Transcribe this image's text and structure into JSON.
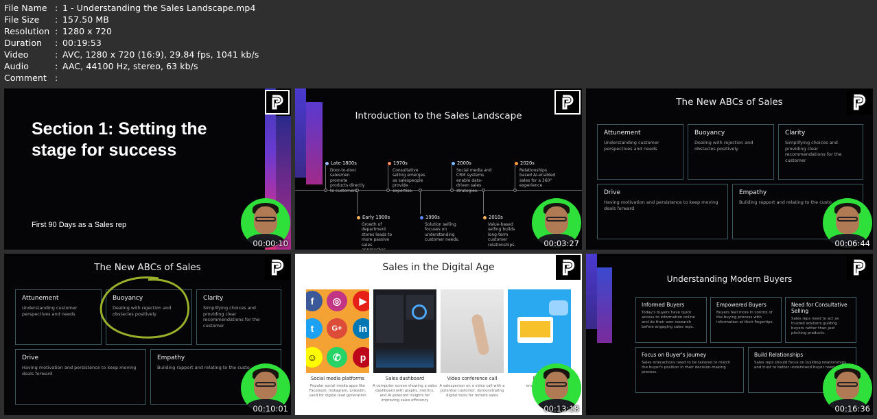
{
  "file_info": [
    {
      "key": "File Name",
      "value": "1 - Understanding the Sales Landscape.mp4"
    },
    {
      "key": "File Size",
      "value": "157.50 MB"
    },
    {
      "key": "Resolution",
      "value": "1280 x 720"
    },
    {
      "key": "Duration",
      "value": "00:19:53"
    },
    {
      "key": "Video",
      "value": "AVC, 1280 x 720 (16:9), 29.84 fps, 1041 kb/s"
    },
    {
      "key": "Audio",
      "value": "AAC, 44100 Hz, stereo, 63 kb/s"
    },
    {
      "key": "Comment",
      "value": ""
    }
  ],
  "separator": ":",
  "thumbs": {
    "t1": {
      "time": "00:00:10",
      "title": "Section 1: Setting the stage for success",
      "subtitle": "First 90 Days as a Sales rep"
    },
    "t2": {
      "time": "00:03:27",
      "title": "Introduction to the Sales Landscape",
      "top_items": [
        {
          "year": "Late 1800s",
          "text": "Door-to-door salesmen promote products directly to customers.",
          "color": "#9ab8ff"
        },
        {
          "year": "1970s",
          "text": "Consultative selling emerges as salespeople provide expertise.",
          "color": "#ff8a5a"
        },
        {
          "year": "2000s",
          "text": "Social media and CRM systems enable data-driven sales strategies.",
          "color": "#7ab8ff"
        },
        {
          "year": "2020s",
          "text": "Relationships based AI-enabled sales for a 360° experience",
          "color": "#ff9a3a"
        }
      ],
      "bottom_items": [
        {
          "year": "Early 1900s",
          "text": "Growth of department stores leads to more passive sales approaches.",
          "color": "#ffb25a"
        },
        {
          "year": "1990s",
          "text": "Solution selling focuses on understanding customer needs.",
          "color": "#5a8aff"
        },
        {
          "year": "2010s",
          "text": "Value-based selling builds long-term customer relationships.",
          "color": "#ffb25a"
        }
      ]
    },
    "t3": {
      "time": "00:06:44",
      "title": "The New ABCs of Sales"
    },
    "t4": {
      "time": "00:10:01",
      "title": "The New ABCs of Sales"
    },
    "abc_cards": [
      {
        "h": "Attunement",
        "d": "Understanding customer perspectives and needs"
      },
      {
        "h": "Buoyancy",
        "d": "Dealing with rejection and obstacles positively"
      },
      {
        "h": "Clarity",
        "d": "Simplifying choices and providing clear recommendations for the customer"
      },
      {
        "h": "Drive",
        "d": "Having motivation and persistence to keep moving deals forward"
      },
      {
        "h": "Empathy",
        "d": "Building rapport and relating to the custo"
      }
    ],
    "t5": {
      "time": "00:13:18",
      "title": "Sales in the Digital Age",
      "items": [
        {
          "cap": "Social media platforms",
          "desc": "Popular social media apps like Facebook, Instagram, LinkedIn, used for digital lead generation"
        },
        {
          "cap": "Sales dashboard",
          "desc": "A computer screen showing a sales dashboard with graphs, metrics, and AI-powered insights for improving sales efficiency"
        },
        {
          "cap": "Video conference call",
          "desc": "A salesperson on a video call with a potential customer, demonstrating digital tools for remote sales"
        },
        {
          "cap": "Email",
          "desc": "email ca nurtu"
        }
      ]
    },
    "t6": {
      "time": "00:16:36",
      "title": "Understanding Modern Buyers",
      "cards": [
        {
          "h": "Informed Buyers",
          "d": "Today's buyers have quick access to information online and do their own research before engaging sales reps."
        },
        {
          "h": "Empowered Buyers",
          "d": "Buyers feel more in control of the buying process with information at their fingertips."
        },
        {
          "h": "Need for Consultative Selling",
          "d": "Sales reps need to act as trusted advisors guiding buyers rather than just pitching products."
        },
        {
          "h": "Focus on Buyer's Journey",
          "d": "Sales interactions need to be tailored to match the buyer's position in their decision-making process."
        },
        {
          "h": "Build Relationships",
          "d": "Sales reps should focus on building relationships and trust to better understand buyer need"
        }
      ]
    }
  },
  "colors": {
    "bg": "#2f2f2f",
    "slide_bg": "#050507",
    "card_border": "#3b5b64",
    "avatar_bg": "#2fe03a",
    "highlight_circle": "#9bb02a"
  }
}
